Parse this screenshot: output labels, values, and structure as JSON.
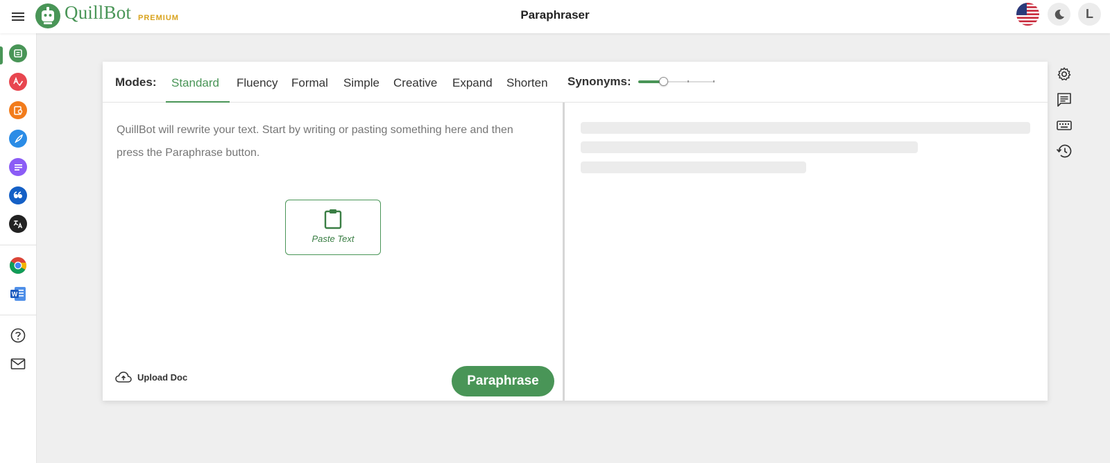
{
  "header": {
    "logo_text": "QuillBot",
    "premium_label": "PREMIUM",
    "page_title": "Paraphraser",
    "avatar_letter": "L",
    "icons": [
      "menu-icon",
      "us-flag-icon",
      "moon-icon"
    ]
  },
  "sidebar": {
    "items": [
      {
        "name": "paraphraser",
        "icon": "paraphraser-icon",
        "color": "#499557",
        "active": true
      },
      {
        "name": "grammar-checker",
        "icon": "grammar-icon",
        "color": "#e8464f"
      },
      {
        "name": "plagiarism-checker",
        "icon": "plagiarism-icon",
        "color": "#f27c1c"
      },
      {
        "name": "co-writer",
        "icon": "quill-icon",
        "color": "#2b8ce6"
      },
      {
        "name": "summarizer",
        "icon": "summarizer-icon",
        "color": "#8b5cf6"
      },
      {
        "name": "citation-generator",
        "icon": "quote-icon",
        "color": "#1560c6"
      },
      {
        "name": "translator",
        "icon": "translate-icon",
        "color": "#222222"
      }
    ],
    "integrations": [
      "chrome-icon",
      "word-icon"
    ],
    "footer": [
      "help-icon",
      "mail-icon"
    ]
  },
  "modes": {
    "label": "Modes:",
    "tabs": [
      "Standard",
      "Fluency",
      "Formal",
      "Simple",
      "Creative",
      "Expand",
      "Shorten"
    ],
    "active": "Standard"
  },
  "synonyms": {
    "label": "Synonyms:",
    "level_fraction": 0.33
  },
  "input": {
    "placeholder": "QuillBot will rewrite your text. Start by writing or pasting something here and then press the Paraphrase button.",
    "paste_label": "Paste Text",
    "upload_label": "Upload Doc",
    "paraphrase_label": "Paraphrase"
  },
  "right_tools": [
    "settings-icon",
    "comment-icon",
    "keyboard-icon",
    "history-icon"
  ],
  "colors": {
    "brand_green": "#499557",
    "premium_gold": "#d9a31e"
  }
}
